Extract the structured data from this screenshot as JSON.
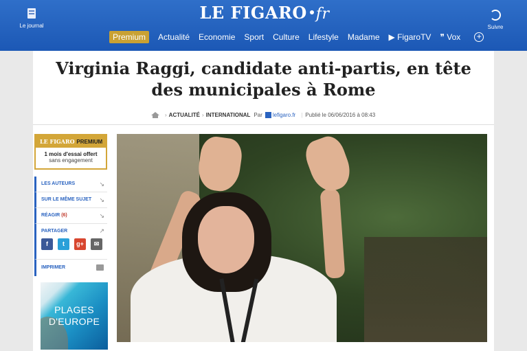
{
  "header": {
    "logo_main": "LE FIGARO",
    "logo_suffix": "fr",
    "journal_label": "Le journal",
    "follow_label": "Suivre",
    "nav": [
      "Premium",
      "Actualité",
      "Economie",
      "Sport",
      "Culture",
      "Lifestyle",
      "Madame",
      "▶ FigaroTV",
      "❞ Vox"
    ]
  },
  "article": {
    "title": "Virginia Raggi, candidate anti-partis, en tête des municipales à Rome",
    "breadcrumb": [
      "ACTUALITÉ",
      "INTERNATIONAL"
    ],
    "by": "Par",
    "source": "lefigaro.fr",
    "published": "Publié le 06/06/2016 à 08:43"
  },
  "promo": {
    "brand": "LE FIGARO",
    "brand_suffix": "PREMIUM",
    "offer": "1 mois d'essai offert",
    "condition": "sans engagement"
  },
  "tools": {
    "authors": "LES AUTEURS",
    "same_subject": "SUR LE MÊME SUJET",
    "react": "RÉAGIR",
    "react_count": "(6)",
    "share": "PARTAGER",
    "print": "IMPRIMER"
  },
  "ad": {
    "line1": "PLAGES",
    "line2": "D'EUROPE"
  },
  "colors": {
    "header_blue": "#1c58b5",
    "premium_gold": "#d3a638",
    "link_blue": "#2a63c0"
  }
}
